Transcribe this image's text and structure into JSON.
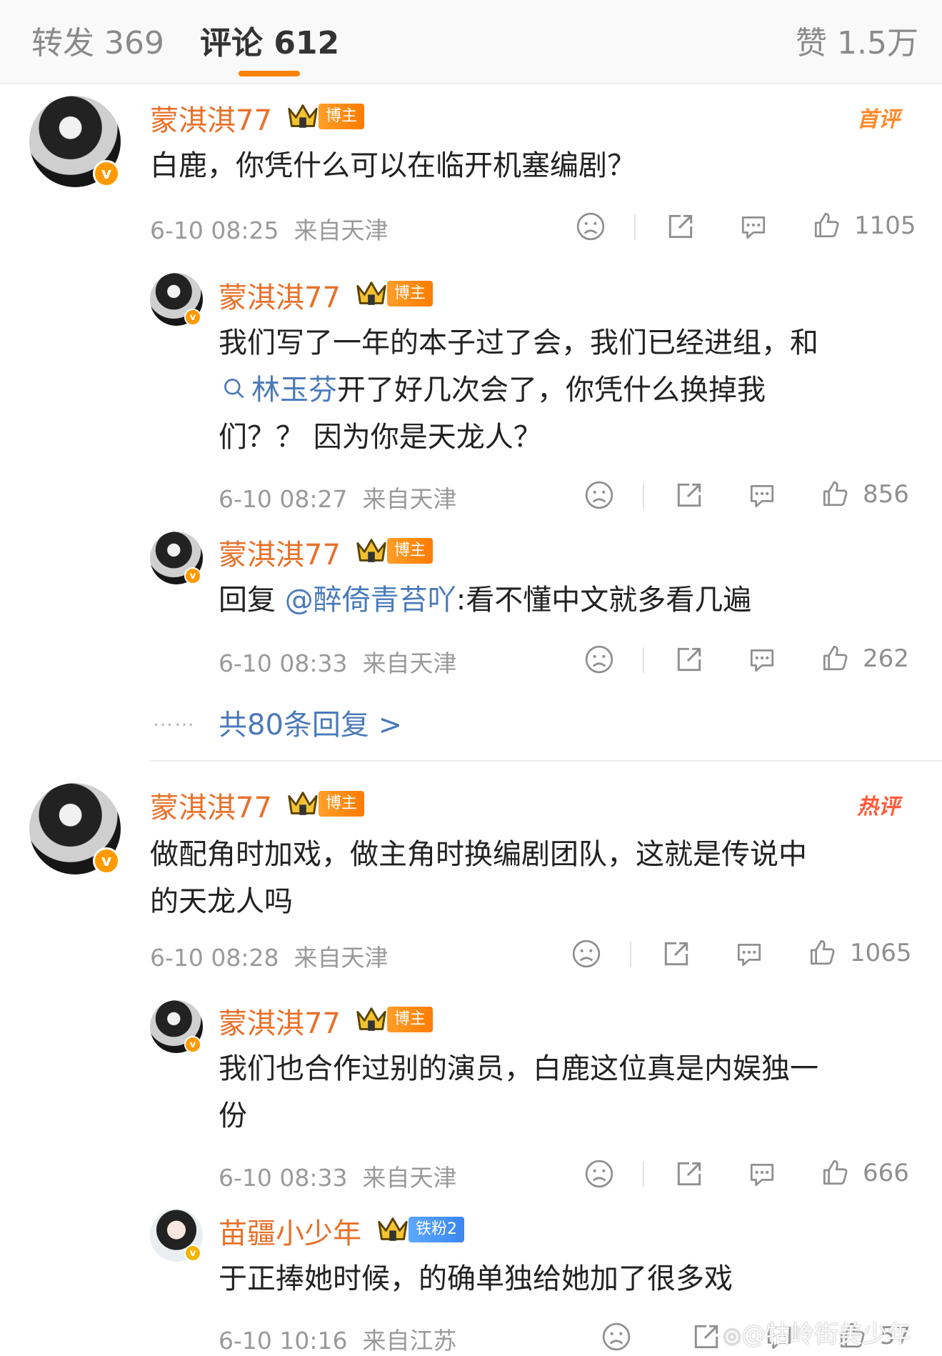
{
  "tabs": {
    "repost": "转发 369",
    "comment": "评论 612",
    "like": "赞 1.5万"
  },
  "comments": [
    {
      "user": "蒙淇淇77",
      "badge": "博主",
      "tag": "首评",
      "text": "白鹿，你凭什么可以在临开机塞编剧？",
      "time": "6-10 08:25",
      "location": "来自天津",
      "likes": "1105",
      "replies": [
        {
          "user": "蒙淇淇77",
          "badge": "博主",
          "text_line1": "我们写了一年的本子过了会，我们已经进组，和",
          "mention": "林玉芬",
          "text_line2_rest": "开了好几次会了，你凭什么换掉我",
          "text_line3": "们？？ 因为你是天龙人？",
          "time": "6-10 08:27",
          "location": "来自天津",
          "likes": "856"
        },
        {
          "user": "蒙淇淇77",
          "badge": "博主",
          "prefix": "回复",
          "mention": "@醉倚青苔吖",
          "text": ":看不懂中文就多看几遍",
          "time": "6-10 08:33",
          "location": "来自天津",
          "likes": "262"
        }
      ],
      "more_dots": "……",
      "more_replies": "共80条回复 >"
    },
    {
      "user": "蒙淇淇77",
      "badge": "博主",
      "tag": "热评",
      "text_line1": "做配角时加戏，做主角时换编剧团队，这就是传说中",
      "text_line2": "的天龙人吗",
      "time": "6-10 08:28",
      "location": "来自天津",
      "likes": "1065",
      "replies": [
        {
          "user": "蒙淇淇77",
          "badge": "博主",
          "text_line1": "我们也合作过别的演员，白鹿这位真是内娱独一",
          "text_line2": "份",
          "time": "6-10 08:33",
          "location": "来自天津",
          "likes": "666"
        },
        {
          "user": "苗疆小少年",
          "badge": "铁粉2",
          "text": "于正捧她时候，的确单独给她加了很多戏",
          "time": "6-10 10:16",
          "location": "来自江苏",
          "likes": "57"
        }
      ]
    }
  ],
  "watermark": "@牯岭街美少年",
  "icons": {
    "dislike": "sad-face-icon",
    "share": "share-icon",
    "reply": "comment-bubble-icon",
    "like": "thumbs-up-icon",
    "search": "search-icon",
    "crown": "crown-icon",
    "weibo": "weibo-logo-icon"
  },
  "colors": {
    "accent": "#ff8200",
    "username": "#e8702a",
    "link": "#4a7ab8",
    "meta": "#9a9a9a"
  }
}
